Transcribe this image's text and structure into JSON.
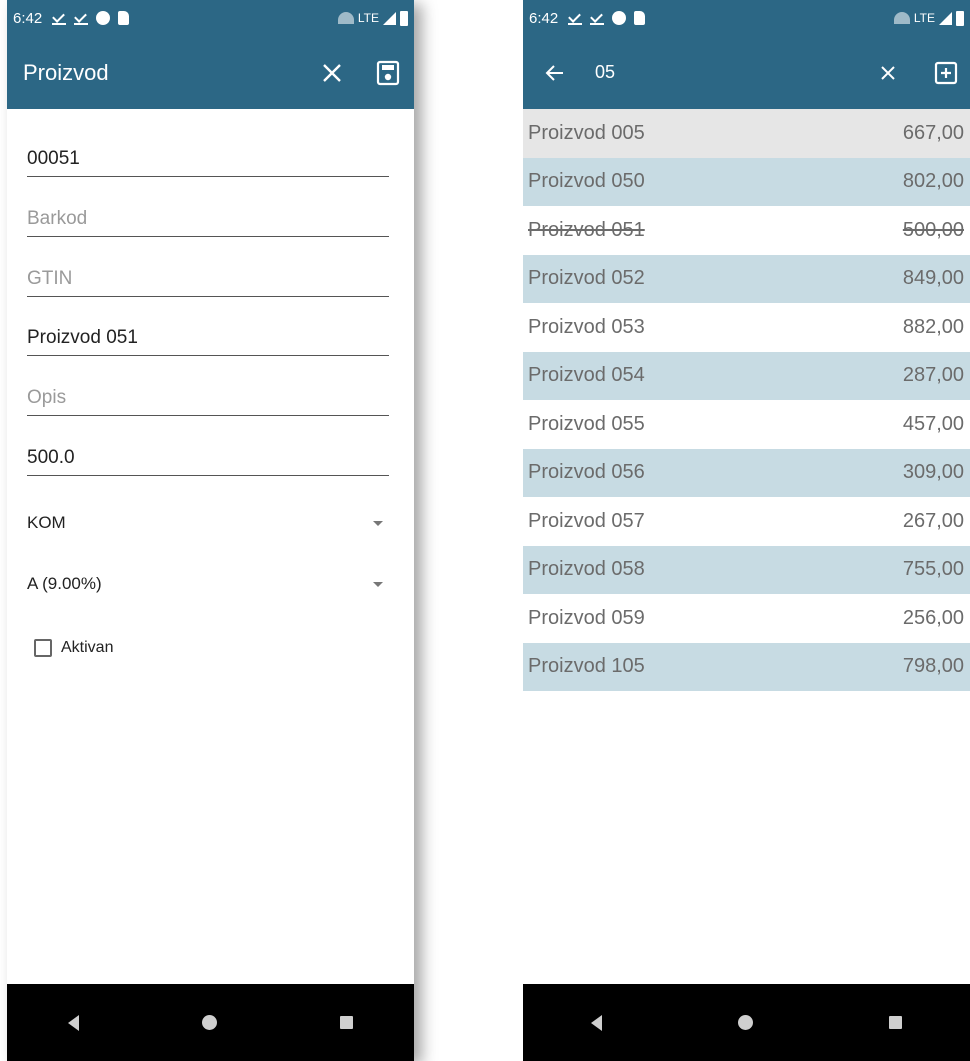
{
  "status_bar": {
    "time": "6:42",
    "network": "LTE"
  },
  "left_screen": {
    "title": "Proizvod",
    "fields": [
      {
        "value": "00051",
        "placeholder": ""
      },
      {
        "value": "",
        "placeholder": "Barkod"
      },
      {
        "value": "",
        "placeholder": "GTIN"
      },
      {
        "value": "Proizvod 051",
        "placeholder": ""
      },
      {
        "value": "",
        "placeholder": "Opis"
      },
      {
        "value": "500.0",
        "placeholder": ""
      }
    ],
    "unit_selected": "KOM",
    "tax_selected": "A (9.00%)",
    "active_label": "Aktivan",
    "active_checked": false
  },
  "right_screen": {
    "search_query": "05",
    "items": [
      {
        "name": "Proizvod 005",
        "price": "667,00",
        "inactive": false
      },
      {
        "name": "Proizvod 050",
        "price": "802,00",
        "inactive": false
      },
      {
        "name": "Proizvod 051",
        "price": "500,00",
        "inactive": true
      },
      {
        "name": "Proizvod 052",
        "price": "849,00",
        "inactive": false
      },
      {
        "name": "Proizvod 053",
        "price": "882,00",
        "inactive": false
      },
      {
        "name": "Proizvod 054",
        "price": "287,00",
        "inactive": false
      },
      {
        "name": "Proizvod 055",
        "price": "457,00",
        "inactive": false
      },
      {
        "name": "Proizvod 056",
        "price": "309,00",
        "inactive": false
      },
      {
        "name": "Proizvod 057",
        "price": "267,00",
        "inactive": false
      },
      {
        "name": "Proizvod 058",
        "price": "755,00",
        "inactive": false
      },
      {
        "name": "Proizvod 059",
        "price": "256,00",
        "inactive": false
      },
      {
        "name": "Proizvod 105",
        "price": "798,00",
        "inactive": false
      }
    ]
  },
  "colors": {
    "app_bar": "#2c6785",
    "row_alt": "#c7dbe3",
    "row_highlight": "#e6e6e6",
    "nav_bar": "#000000"
  },
  "icons": {
    "close": "close-icon",
    "save": "save-icon",
    "back": "arrow-back-icon",
    "add": "add-box-icon"
  }
}
